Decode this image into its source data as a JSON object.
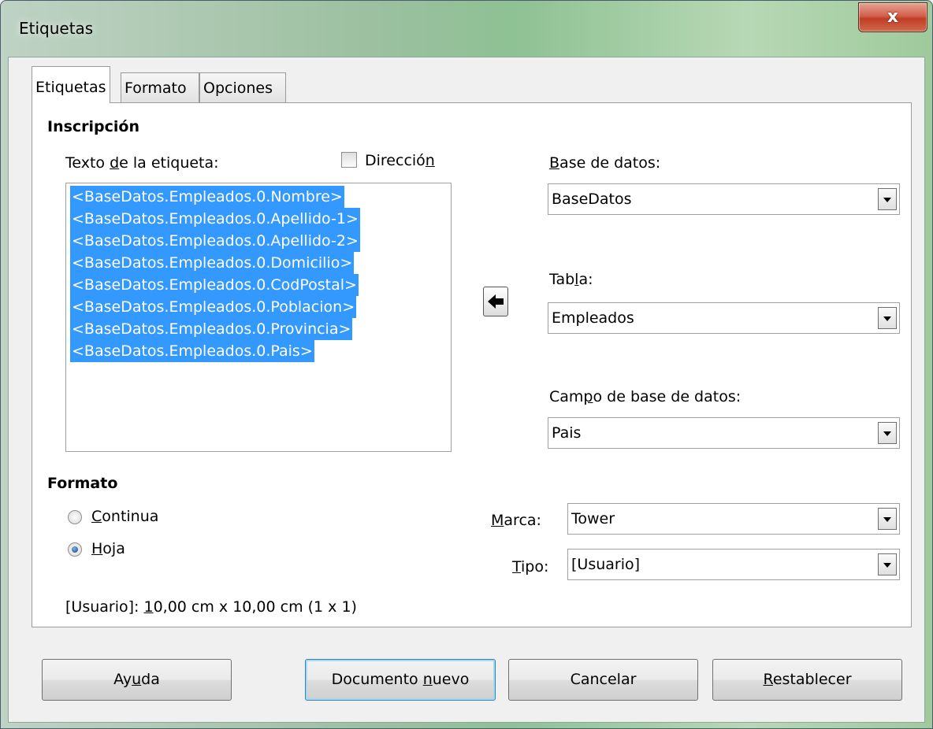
{
  "window": {
    "title": "Etiquetas",
    "close_glyph": "x"
  },
  "tabs": [
    {
      "label": "Etiquetas",
      "active": true
    },
    {
      "label": "Formato",
      "active": false
    },
    {
      "label": "Opciones",
      "active": false
    }
  ],
  "inscripcion": {
    "heading": "Inscripción",
    "label_text_label": {
      "pre": "Texto ",
      "mnemonic": "d",
      "post": "e la etiqueta:"
    },
    "direccion": {
      "pre": "Direcció",
      "mnemonic": "n",
      "post": "",
      "checked": false
    },
    "label_lines": [
      "<BaseDatos.Empleados.0.Nombre>",
      "<BaseDatos.Empleados.0.Apellido-1>",
      "<BaseDatos.Empleados.0.Apellido-2>",
      "<BaseDatos.Empleados.0.Domicilio>",
      "<BaseDatos.Empleados.0.CodPostal>",
      "<BaseDatos.Empleados.0.Poblacion>",
      "<BaseDatos.Empleados.0.Provincia>",
      "<BaseDatos.Empleados.0.Pais>"
    ],
    "insert_icon": "arrow-left-icon",
    "database": {
      "label_pre": "",
      "label_mnemonic": "B",
      "label_post": "ase de datos:",
      "value": "BaseDatos"
    },
    "table": {
      "label_pre": "Tab",
      "label_mnemonic": "l",
      "label_post": "a:",
      "value": "Empleados"
    },
    "field": {
      "label_pre": "Cam",
      "label_mnemonic": "p",
      "label_post": "o de base de datos:",
      "value": "Pais"
    }
  },
  "formato": {
    "heading": "Formato",
    "continua": {
      "mnemonic": "C",
      "post": "ontinua",
      "selected": false
    },
    "hoja": {
      "mnemonic": "H",
      "post": "oja",
      "selected": true
    },
    "marca": {
      "mnemonic": "M",
      "post": "arca:",
      "value": "Tower"
    },
    "tipo": {
      "mnemonic": "T",
      "post": "ipo:",
      "value": "[Usuario]"
    },
    "summary": {
      "pre": "[Usuario]: ",
      "mnemonic": "1",
      "post": "0,00 cm x 10,00 cm (1 x 1)"
    }
  },
  "buttons": {
    "help": {
      "pre": "Ay",
      "mnemonic": "u",
      "post": "da"
    },
    "new_document": {
      "pre": "Documento ",
      "mnemonic": "n",
      "post": "uevo"
    },
    "cancel": {
      "pre": "Cancelar",
      "mnemonic": "",
      "post": ""
    },
    "reset": {
      "pre": "",
      "mnemonic": "R",
      "post": "establecer"
    }
  },
  "colors": {
    "selection": "#3399ff",
    "close_button": "#c13d25",
    "title_bar": "#8ec193"
  }
}
